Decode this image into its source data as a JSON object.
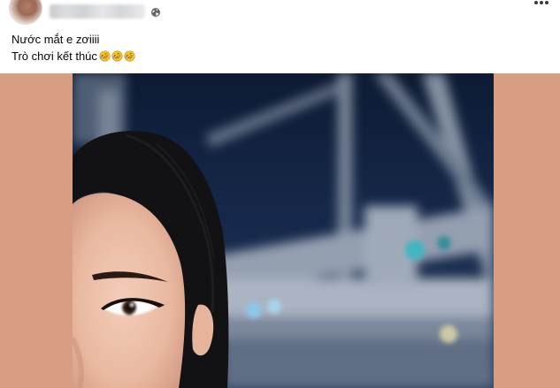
{
  "post": {
    "author": {
      "avatar_icon": "profile-avatar",
      "privacy_icon": "globe-icon"
    },
    "menu_icon": "more-horizontal-icon",
    "caption_lines": [
      "Nước mắt e zơiiii",
      "Trò chơi kết thúc"
    ],
    "caption_emoji": "rolling-on-floor-laughing",
    "caption_emoji_count": 3,
    "media": {
      "background_color": "#d89e81",
      "frame_color": "#0b1930"
    }
  }
}
